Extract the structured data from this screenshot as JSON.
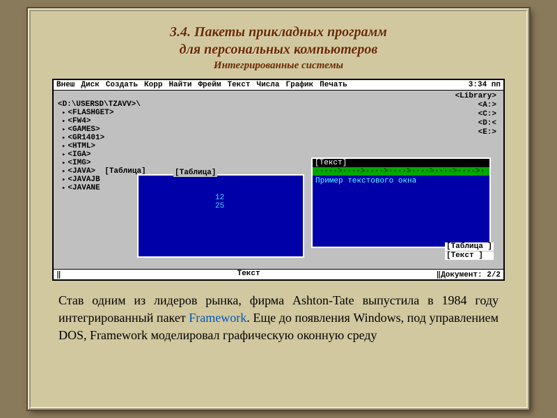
{
  "slide": {
    "title_line1": "3.4. Пакеты прикладных программ",
    "title_line2": "для персональных компьютеров",
    "subtitle": "Интегрированные системы"
  },
  "menubar": {
    "items": [
      "Внеш",
      "Диск",
      "Создать",
      "Корр",
      "Найти",
      "Фрейм",
      "Текст",
      "Числа",
      "График",
      "Печать"
    ],
    "time": "3:34 пп"
  },
  "library": {
    "title": "<Library>",
    "drives": [
      "<A:>",
      "<C:>",
      "<D:<",
      "<E:>"
    ]
  },
  "tree": {
    "path": "<D:\\USERSD\\TZAVV>\\",
    "items": [
      "<FLASHGET>",
      "<FW4>",
      "<GAMES>",
      "<GR1401>",
      "<HTML>",
      "<IGA>",
      "<IMG>",
      "<JAVA>  [Таблица]",
      "<JAVAJB",
      "<JAVANE"
    ]
  },
  "table_window": {
    "label": "[Таблица]",
    "n1": "12",
    "n2": "25"
  },
  "text_window": {
    "title": "[Текст]",
    "greenbar": "·····>····>····>····>····>····>····>·",
    "content": "Пример текстового окна"
  },
  "bottom": {
    "l1": "[Таблица ]",
    "l2": "[Текст   ]"
  },
  "status": {
    "left": "‖",
    "mid": "Текст",
    "right": "‖Документ: 2/2"
  },
  "caption": {
    "p1a": "Став одним из лидеров рынка, фирма Ashton-Tate выпустила в  1984 году  интегрированный пакет ",
    "hl1": "Framework",
    "p1b": ". Еще до появления Windows, под управлением DOS,  Framework моделировал графическую оконную среду"
  }
}
